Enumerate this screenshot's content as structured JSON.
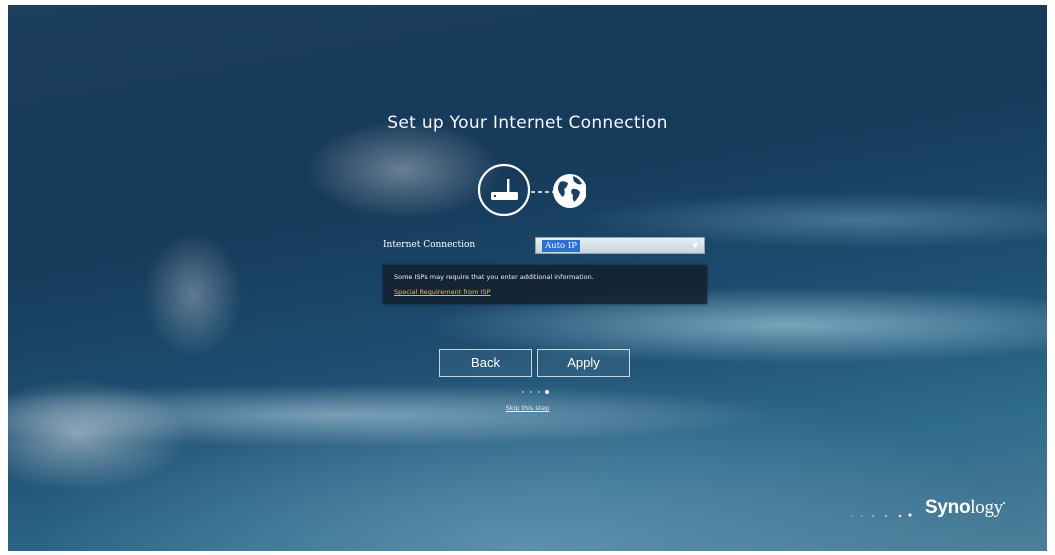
{
  "page": {
    "title": "Set up Your Internet Connection"
  },
  "icons": {
    "left": "router-icon",
    "right": "globe-icon"
  },
  "connection": {
    "label": "Internet Connection",
    "selected": "Auto IP"
  },
  "info": {
    "text": "Some ISPs may require that you enter additional information.",
    "link": "Special Requirement from ISP",
    "link_color": "#e8c030"
  },
  "actions": {
    "back_label": "Back",
    "apply_label": "Apply"
  },
  "progress": {
    "total_steps": 4,
    "current_step": 4
  },
  "skip_label": "Skip this step",
  "brand": {
    "logo_bold": "Syno",
    "logo_light": "logy"
  }
}
